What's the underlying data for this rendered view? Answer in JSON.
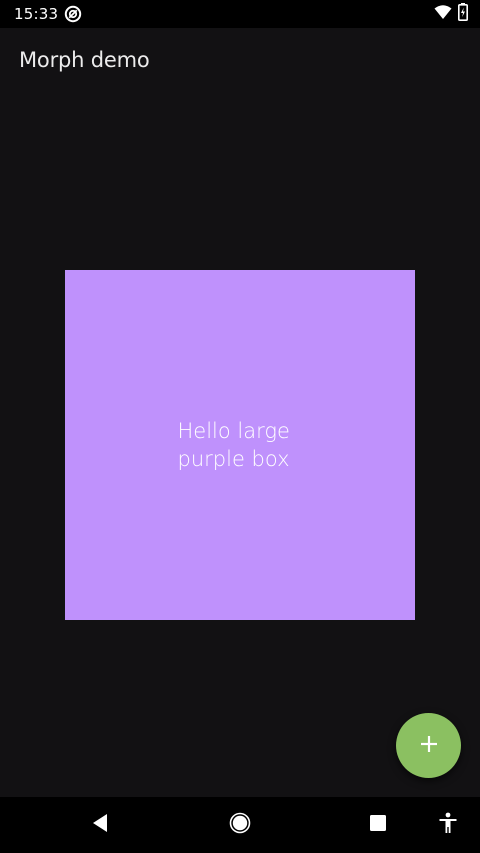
{
  "status_bar": {
    "time": "15:33",
    "icons": [
      "app-notification-icon",
      "wifi-icon",
      "battery-charging-icon"
    ]
  },
  "app_bar": {
    "title": "Morph demo"
  },
  "main": {
    "box_text": "Hello large\npurple box",
    "box_color": "#bf91fc"
  },
  "fab": {
    "icon": "plus-icon",
    "color": "#8bc061"
  },
  "navigation_bar": {
    "buttons": [
      "back-icon",
      "home-icon",
      "recents-icon",
      "accessibility-icon"
    ]
  },
  "colors": {
    "background": "#121113",
    "system_bars": "#000000"
  }
}
